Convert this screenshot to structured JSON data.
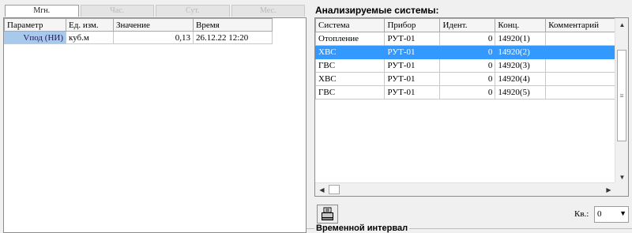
{
  "period_tabs": [
    {
      "label": "Мгн.",
      "active": true
    },
    {
      "label": "Час.",
      "active": false
    },
    {
      "label": "Сут.",
      "active": false
    },
    {
      "label": "Мес.",
      "active": false
    }
  ],
  "params_table": {
    "headers": [
      "Параметр",
      "Ед. изм.",
      "Значение",
      "Время"
    ],
    "rows": [
      {
        "param": "Vпод (НИ)",
        "unit": "куб.м",
        "value": "0,13",
        "time": "26.12.22 12:20"
      }
    ]
  },
  "systems": {
    "title": "Анализируемые системы:",
    "headers": [
      "Система",
      "Прибор",
      "Идент.",
      "Конц.",
      "Комментарий"
    ],
    "rows": [
      {
        "system": "Отопление",
        "device": "РУТ-01",
        "ident": "0",
        "conc": "14920(1)",
        "comment": ""
      },
      {
        "system": "ХВС",
        "device": "РУТ-01",
        "ident": "0",
        "conc": "14920(2)",
        "comment": "",
        "selected": true
      },
      {
        "system": "ГВС",
        "device": "РУТ-01",
        "ident": "0",
        "conc": "14920(3)",
        "comment": ""
      },
      {
        "system": "ХВС",
        "device": "РУТ-01",
        "ident": "0",
        "conc": "14920(4)",
        "comment": ""
      },
      {
        "system": "ГВС",
        "device": "РУТ-01",
        "ident": "0",
        "conc": "14920(5)",
        "comment": ""
      }
    ],
    "selected_color": "#3399ff"
  },
  "print_button": {
    "icon": "printer-icon"
  },
  "kv": {
    "label": "Кв.:",
    "value": "0"
  },
  "time_interval": {
    "label": "Временной интервал"
  }
}
